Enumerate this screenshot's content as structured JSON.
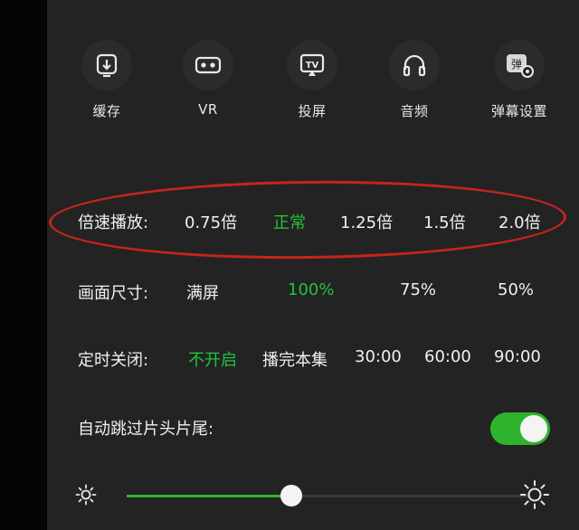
{
  "top_icons": [
    {
      "label": "缓存",
      "icon": "download-box-icon"
    },
    {
      "label": "VR",
      "icon": "vr-goggles-icon"
    },
    {
      "label": "投屏",
      "icon": "tv-cast-icon"
    },
    {
      "label": "音频",
      "icon": "headphones-icon"
    },
    {
      "label": "弹幕设置",
      "icon": "danmaku-settings-icon",
      "glyph": "弹"
    }
  ],
  "speed": {
    "label": "倍速播放:",
    "options": [
      "0.75倍",
      "正常",
      "1.25倍",
      "1.5倍",
      "2.0倍"
    ],
    "selected": "正常"
  },
  "size": {
    "label": "画面尺寸:",
    "options": [
      "满屏",
      "100%",
      "75%",
      "50%"
    ],
    "selected": "100%"
  },
  "timer": {
    "label": "定时关闭:",
    "options": [
      "不开启",
      "播完本集",
      "30:00",
      "60:00",
      "90:00"
    ],
    "selected": "不开启"
  },
  "skip": {
    "label": "自动跳过片头片尾:",
    "enabled": true
  },
  "brightness": {
    "level": 0.41,
    "min_icon": "sun-small-icon",
    "max_icon": "sun-large-icon"
  },
  "colors": {
    "accent_green": "#22c23c",
    "highlight_red": "#c6241c",
    "panel_bg": "#232323"
  }
}
